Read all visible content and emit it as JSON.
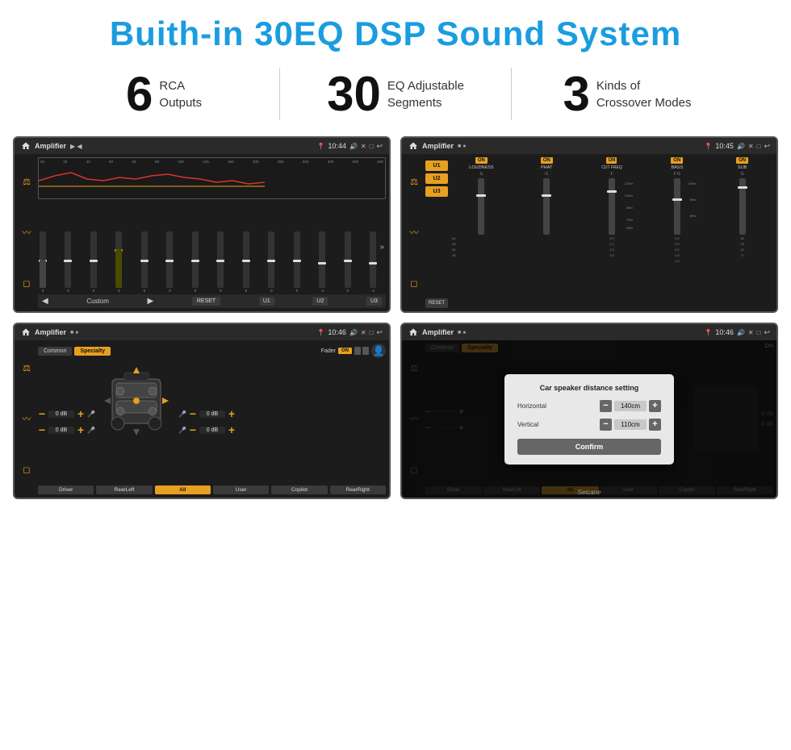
{
  "header": {
    "title": "Buith-in 30EQ DSP Sound System"
  },
  "stats": [
    {
      "number": "6",
      "label": "RCA\nOutputs"
    },
    {
      "number": "30",
      "label": "EQ Adjustable\nSegments"
    },
    {
      "number": "3",
      "label": "Kinds of\nCrossover Modes"
    }
  ],
  "screens": [
    {
      "id": "eq-screen",
      "title": "Amplifier",
      "time": "10:44",
      "type": "eq"
    },
    {
      "id": "amp-screen",
      "title": "Amplifier",
      "time": "10:45",
      "type": "amp"
    },
    {
      "id": "fader-screen",
      "title": "Amplifier",
      "time": "10:46",
      "type": "fader"
    },
    {
      "id": "dialog-screen",
      "title": "Amplifier",
      "time": "10:46",
      "type": "dialog"
    }
  ],
  "eq": {
    "frequencies": [
      "25",
      "32",
      "40",
      "50",
      "63",
      "80",
      "100",
      "125",
      "160",
      "200",
      "250",
      "320",
      "400",
      "500",
      "630"
    ],
    "values": [
      "0",
      "0",
      "0",
      "5",
      "0",
      "0",
      "0",
      "0",
      "0",
      "0",
      "0",
      "-1",
      "0",
      "-1"
    ],
    "label": "Custom",
    "buttons": [
      "RESET",
      "U1",
      "U2",
      "U3"
    ]
  },
  "amp": {
    "presets": [
      "U1",
      "U2",
      "U3"
    ],
    "channels": [
      "LOUDNESS",
      "PHAT",
      "CUT FREQ",
      "BASS",
      "SUB"
    ],
    "resetLabel": "RESET"
  },
  "fader": {
    "tabs": [
      "Common",
      "Specialty"
    ],
    "activeTab": "Specialty",
    "faderLabel": "Fader",
    "onLabel": "ON",
    "rows": [
      {
        "value": "0 dB"
      },
      {
        "value": "0 dB"
      },
      {
        "value": "0 dB"
      },
      {
        "value": "0 dB"
      }
    ],
    "buttons": [
      "Driver",
      "RearLeft",
      "All",
      "User",
      "Copilot",
      "RearRight"
    ]
  },
  "dialog": {
    "title": "Car speaker distance setting",
    "fields": [
      {
        "label": "Horizontal",
        "value": "140cm"
      },
      {
        "label": "Vertical",
        "value": "110cm"
      }
    ],
    "confirmLabel": "Confirm",
    "rightDb": [
      "0 dB",
      "0 dB"
    ]
  },
  "watermark": "Seicane"
}
